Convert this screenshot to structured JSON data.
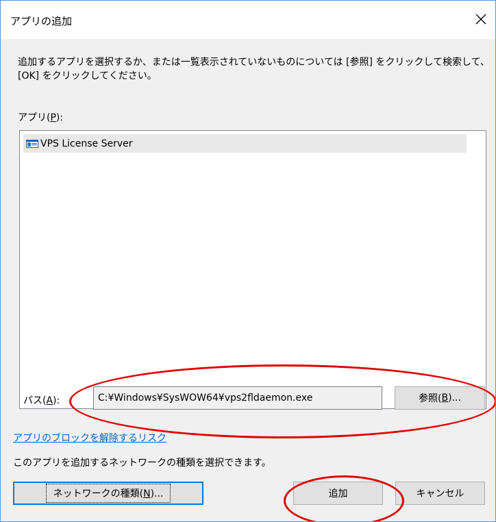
{
  "window": {
    "title": "アプリの追加"
  },
  "instructions": "追加するアプリを選択するか、または一覧表示されていないものについては [参照] をクリックして検索して、[OK] をクリックしてください。",
  "apps": {
    "label_prefix": "アプリ(",
    "label_key": "P",
    "label_suffix": "):",
    "items": [
      {
        "label": "VPS License Server",
        "icon": "app-window-icon",
        "selected": true
      }
    ]
  },
  "path": {
    "label_prefix": "パス(",
    "label_key": "A",
    "label_suffix": "):",
    "value": "C:¥Windows¥SysWOW64¥vps2fldaemon.exe"
  },
  "browse_button": {
    "prefix": "参照(",
    "key": "B",
    "suffix": ")..."
  },
  "unblock_link": "アプリのブロックを解除するリスク",
  "network_text": "このアプリを追加するネットワークの種類を選択できます。",
  "network_button": {
    "prefix": "ネットワークの種類(",
    "key": "N",
    "suffix": ")..."
  },
  "add_button": "追加",
  "cancel_button": "キャンセル",
  "colors": {
    "window_border": "#4a9ae3",
    "content_background": "#f0f0f0",
    "link": "#0066cc",
    "focus_border": "#0078d7",
    "annotation": "#e00000"
  }
}
